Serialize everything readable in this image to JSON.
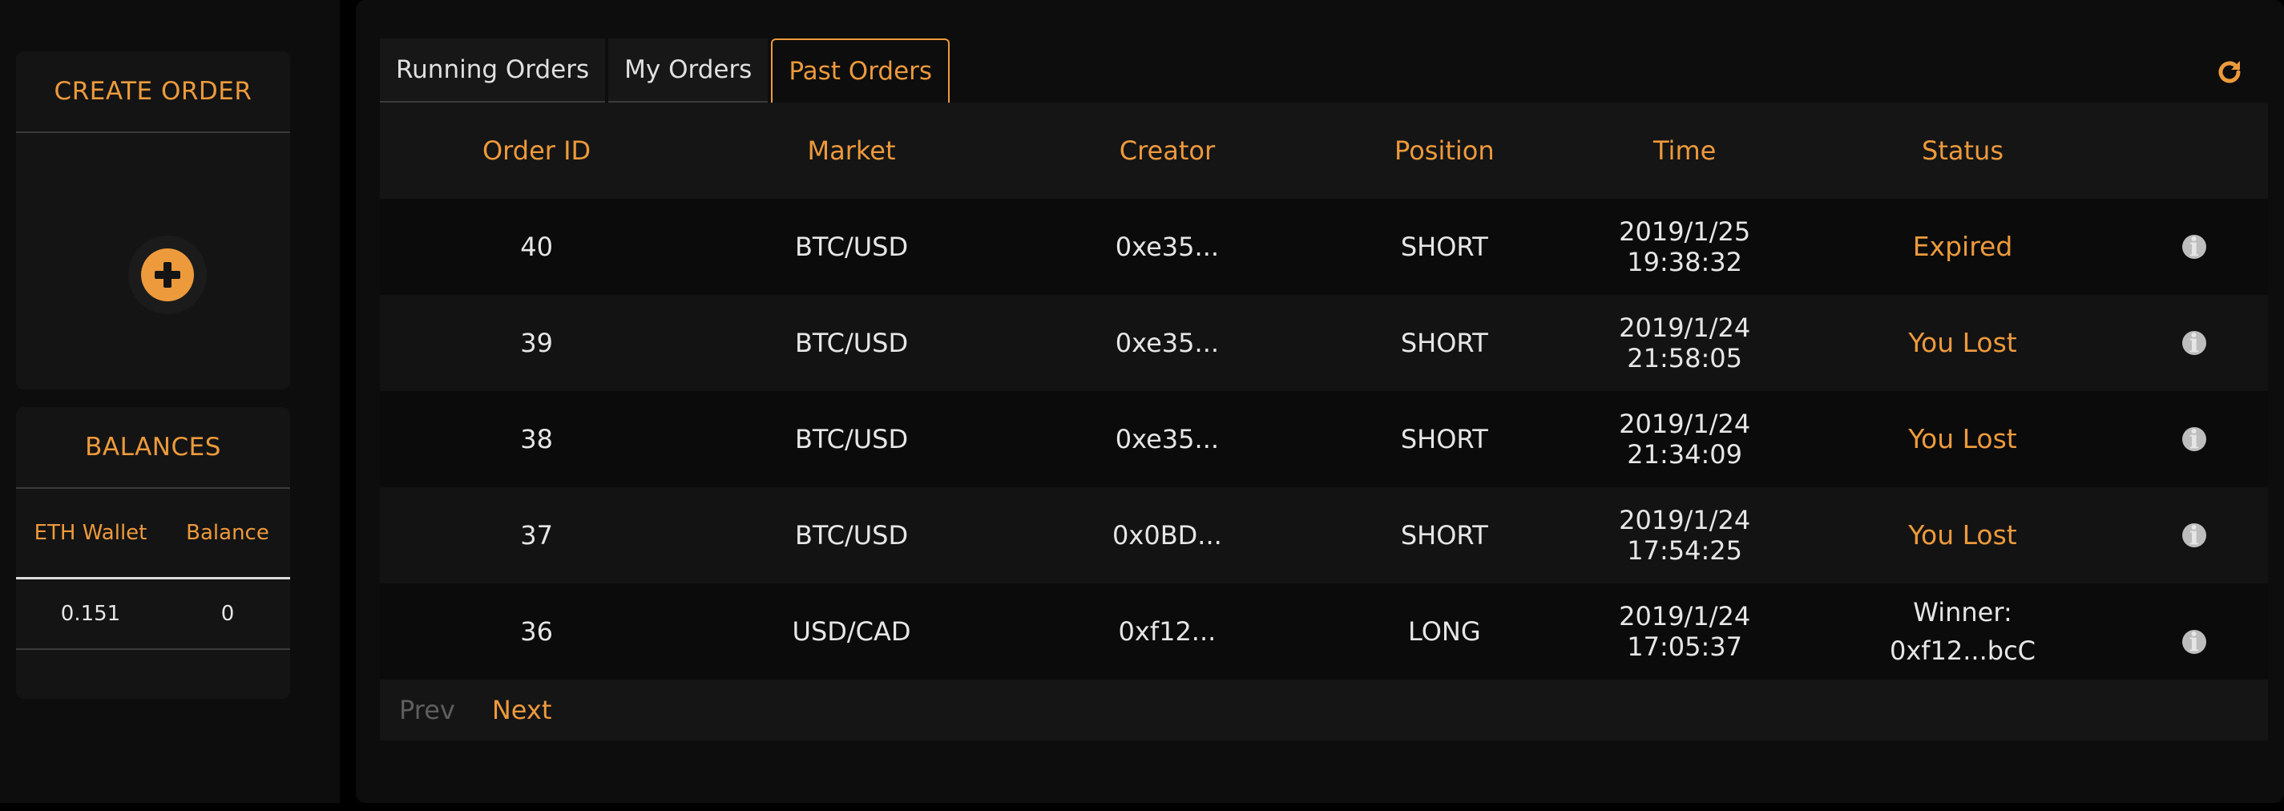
{
  "sidebar": {
    "create_order": {
      "title": "CREATE ORDER",
      "add_icon": "plus-circle-icon"
    },
    "balances": {
      "title": "BALANCES",
      "headers": [
        "ETH Wallet",
        "Balance"
      ],
      "values": [
        "0.151",
        "0"
      ]
    }
  },
  "main": {
    "tabs": [
      "Running Orders",
      "My Orders",
      "Past Orders"
    ],
    "active_tab": "Past Orders",
    "refresh_icon": "refresh-icon",
    "table": {
      "headers": [
        "Order ID",
        "Market",
        "Creator",
        "Position",
        "Time",
        "Status"
      ],
      "rows": [
        {
          "id": "40",
          "market": "BTC/USD",
          "creator": "0xe35...",
          "position": "SHORT",
          "time": "2019/1/25 19:38:32",
          "status": "Expired",
          "status_line2": ""
        },
        {
          "id": "39",
          "market": "BTC/USD",
          "creator": "0xe35...",
          "position": "SHORT",
          "time": "2019/1/24 21:58:05",
          "status": "You Lost",
          "status_line2": ""
        },
        {
          "id": "38",
          "market": "BTC/USD",
          "creator": "0xe35...",
          "position": "SHORT",
          "time": "2019/1/24 21:34:09",
          "status": "You Lost",
          "status_line2": ""
        },
        {
          "id": "37",
          "market": "BTC/USD",
          "creator": "0x0BD...",
          "position": "SHORT",
          "time": "2019/1/24 17:54:25",
          "status": "You Lost",
          "status_line2": ""
        },
        {
          "id": "36",
          "market": "USD/CAD",
          "creator": "0xf12...",
          "position": "LONG",
          "time": "2019/1/24 17:05:37",
          "status": "Winner:",
          "status_line2": "0xf12...bcC"
        }
      ]
    },
    "pager": {
      "prev": "Prev",
      "next": "Next"
    }
  },
  "colors": {
    "accent": "#ed9a3c",
    "background": "#000000",
    "panel": "#141414"
  }
}
